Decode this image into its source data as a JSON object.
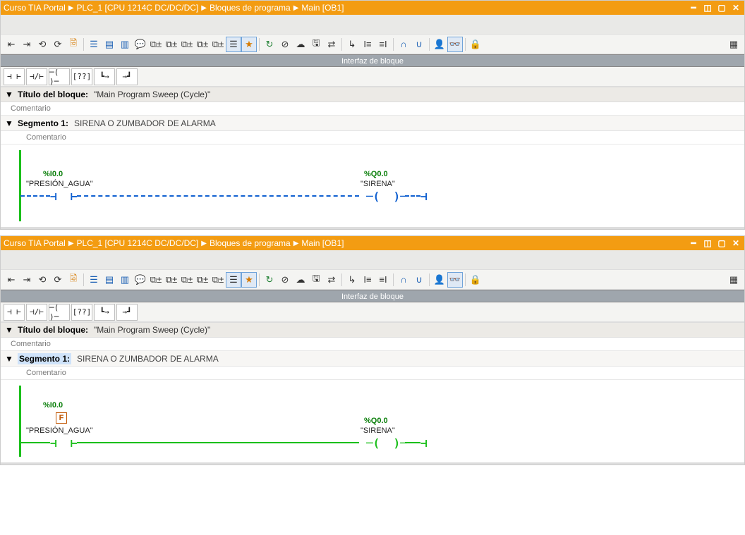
{
  "breadcrumb": {
    "root": "Curso TIA Portal",
    "plc": "PLC_1 [CPU 1214C DC/DC/DC]",
    "folder": "Bloques de programa",
    "block": "Main [OB1]"
  },
  "interface_bar": "Interfaz de bloque",
  "block_title": {
    "label": "Título del bloque:",
    "value": "\"Main Program Sweep (Cycle)\"",
    "comment": "Comentario"
  },
  "segment": {
    "label": "Segmento 1:",
    "desc": "SIRENA O ZUMBADOR DE ALARMA",
    "comment": "Comentario"
  },
  "lad_palette": {
    "nopen": "⊣ ⊢",
    "nclosed": "⊣/⊢",
    "coil": "─( )─",
    "box": "[??]",
    "branch_open": "┗→",
    "branch_close": "→┛"
  },
  "network1": {
    "in_addr": "%I0.0",
    "in_sym": "\"PRESIÓN_AGUA\"",
    "out_addr": "%Q0.0",
    "out_sym": "\"SIRENA\"",
    "forced": false
  },
  "network2": {
    "in_addr": "%I0.0",
    "in_sym": "\"PRESIÓN_AGUA\"",
    "out_addr": "%Q0.0",
    "out_sym": "\"SIRENA\"",
    "forced": true,
    "forced_label": "F"
  },
  "colors": {
    "accent": "#f39c12",
    "online_true": "#1bbf1b",
    "online_false_dashed": "#1060d0"
  }
}
